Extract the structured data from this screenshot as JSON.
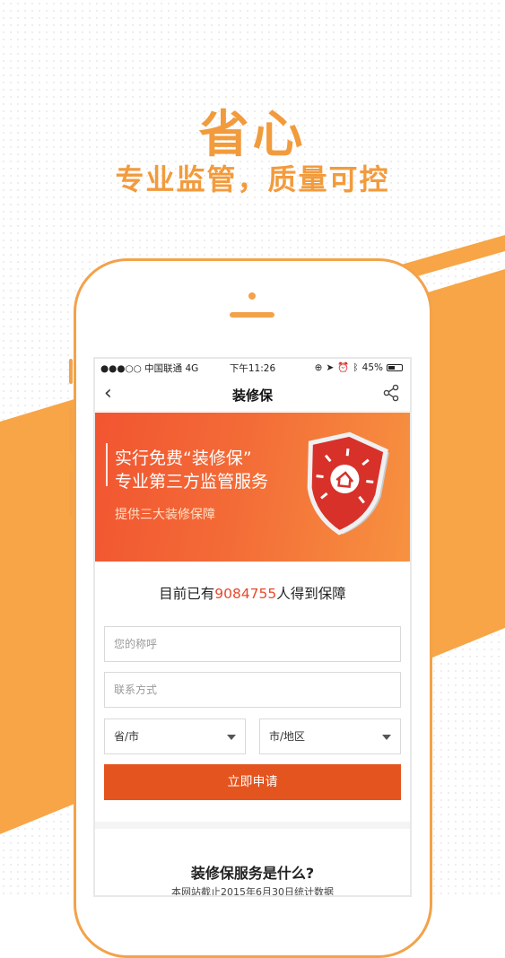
{
  "promo": {
    "headline": "省心",
    "subheadline": "专业监管，质量可控"
  },
  "status_bar": {
    "carrier": "●●●○○ 中国联通  4G",
    "time": "下午11:26",
    "battery": "45%"
  },
  "nav": {
    "back_icon": "chevron-left-icon",
    "title": "装修保",
    "share_icon": "share-icon"
  },
  "banner": {
    "line1": "实行免费“装修保”",
    "line2": "专业第三方监管服务",
    "line3": "提供三大装修保障",
    "graphic": "shield-house-icon"
  },
  "counter": {
    "prefix": "目前已有",
    "number": "9084755",
    "suffix": "人得到保障"
  },
  "form": {
    "name_placeholder": "您的称呼",
    "contact_placeholder": "联系方式",
    "province_select": "省/市",
    "city_select": "市/地区",
    "submit_label": "立即申请"
  },
  "info": {
    "title": "装修保服务是什么?",
    "subtitle": "本网站截止2015年6月30日统计数据"
  },
  "colors": {
    "accent_orange": "#f3a24a",
    "button_red": "#e4541f",
    "number_red": "#e8482c"
  }
}
